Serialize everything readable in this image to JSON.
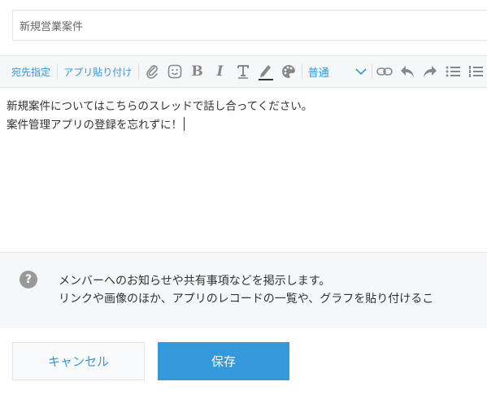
{
  "title_field": {
    "value": "新規営業案件"
  },
  "toolbar": {
    "recipient_label": "宛先指定",
    "app_paste_label": "アプリ貼り付け",
    "font_size_value": "普通",
    "icons": [
      "paperclip-icon",
      "emoji-icon",
      "bold-icon",
      "italic-icon",
      "text-format-icon",
      "pencil-icon",
      "palette-icon",
      "link-icon",
      "undo-icon",
      "redo-icon",
      "bulleted-list-icon",
      "numbered-list-icon"
    ]
  },
  "editor": {
    "lines": [
      "新規案件についてはこちらのスレッドで話し合ってください。",
      "案件管理アプリの登録を忘れずに！"
    ]
  },
  "info": {
    "icon": "question-icon",
    "lines": [
      "メンバーへのお知らせや共有事項などを掲示します。",
      "リンクや画像のほか、アプリのレコードの一覧や、グラフを貼り付けるこ"
    ]
  },
  "buttons": {
    "cancel": "キャンセル",
    "save": "保存"
  },
  "colors": {
    "accent": "#3498db",
    "toolbar_bg": "#f5f7f9",
    "icon": "#888888"
  }
}
